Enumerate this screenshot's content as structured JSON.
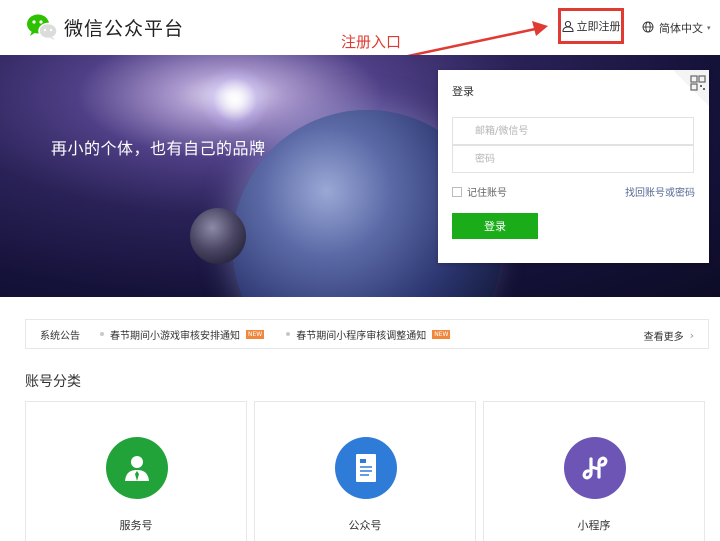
{
  "header": {
    "logo_text": "微信公众平台",
    "register_label": "立即注册",
    "language_label": "简体中文",
    "annotation_text": "注册入口"
  },
  "banner": {
    "slogan": "再小的个体，也有自己的品牌"
  },
  "login": {
    "title": "登录",
    "account_placeholder": "邮箱/微信号",
    "password_placeholder": "密码",
    "remember_label": "记住账号",
    "forgot_label": "找回账号或密码",
    "submit_label": "登录"
  },
  "notice": {
    "label": "系统公告",
    "items": [
      {
        "text": "春节期间小游戏审核安排通知",
        "badge": "NEW"
      },
      {
        "text": "春节期间小程序审核调整通知",
        "badge": "NEW"
      }
    ],
    "more_label": "查看更多"
  },
  "accounts": {
    "section_title": "账号分类",
    "cards": [
      {
        "label": "服务号",
        "color": "#21a33a",
        "icon": "service-account-icon"
      },
      {
        "label": "公众号",
        "color": "#2f7cd8",
        "icon": "official-account-icon"
      },
      {
        "label": "小程序",
        "color": "#6d55b6",
        "icon": "mini-program-icon"
      }
    ]
  },
  "colors": {
    "brand_green": "#1aad19",
    "annotation_red": "#e03b32",
    "link_blue": "#576b95"
  }
}
